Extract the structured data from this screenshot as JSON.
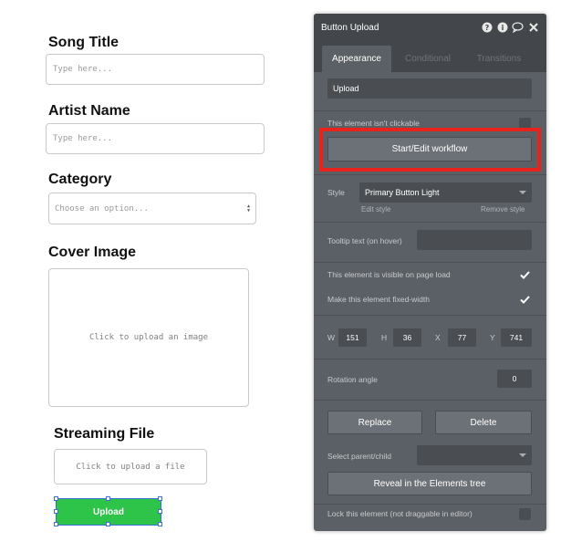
{
  "form": {
    "song_title_label": "Song Title",
    "song_title_placeholder": "Type here...",
    "artist_name_label": "Artist Name",
    "artist_name_placeholder": "Type here...",
    "category_label": "Category",
    "category_placeholder": "Choose an option...",
    "cover_image_label": "Cover Image",
    "cover_image_upload_text": "Click to upload an image",
    "streaming_file_label": "Streaming File",
    "streaming_file_upload_text": "Click to upload a file",
    "upload_button_label": "Upload"
  },
  "panel": {
    "title": "Button Upload",
    "icons": [
      "help-icon",
      "info-icon",
      "comment-icon",
      "close-icon"
    ],
    "tabs": [
      {
        "label": "Appearance",
        "active": true
      },
      {
        "label": "Conditional",
        "active": false
      },
      {
        "label": "Transitions",
        "active": false
      }
    ],
    "text_value": "Upload",
    "not_clickable_label": "This element isn't clickable",
    "not_clickable_checked": false,
    "workflow_button_label": "Start/Edit workflow",
    "style_label": "Style",
    "style_value": "Primary Button Light",
    "edit_style_label": "Edit style",
    "remove_style_label": "Remove style",
    "tooltip_label": "Tooltip text (on hover)",
    "tooltip_value": "",
    "visible_on_load_label": "This element is visible on page load",
    "visible_on_load_checked": true,
    "fixed_width_label": "Make this element fixed-width",
    "fixed_width_checked": true,
    "w_label": "W",
    "w_value": "151",
    "h_label": "H",
    "h_value": "36",
    "x_label": "X",
    "x_value": "77",
    "y_label": "Y",
    "y_value": "741",
    "rotation_label": "Rotation angle",
    "rotation_value": "0",
    "replace_button_label": "Replace",
    "delete_button_label": "Delete",
    "parent_child_label": "Select parent/child",
    "parent_child_value": "",
    "reveal_button_label": "Reveal in the Elements tree",
    "lock_label": "Lock this element (not draggable in editor)",
    "lock_checked": false
  },
  "colors": {
    "highlight": "#e8231b",
    "upload_button": "#2ec44a",
    "panel_bg": "#5b6066",
    "selection": "#3b6fd8"
  }
}
